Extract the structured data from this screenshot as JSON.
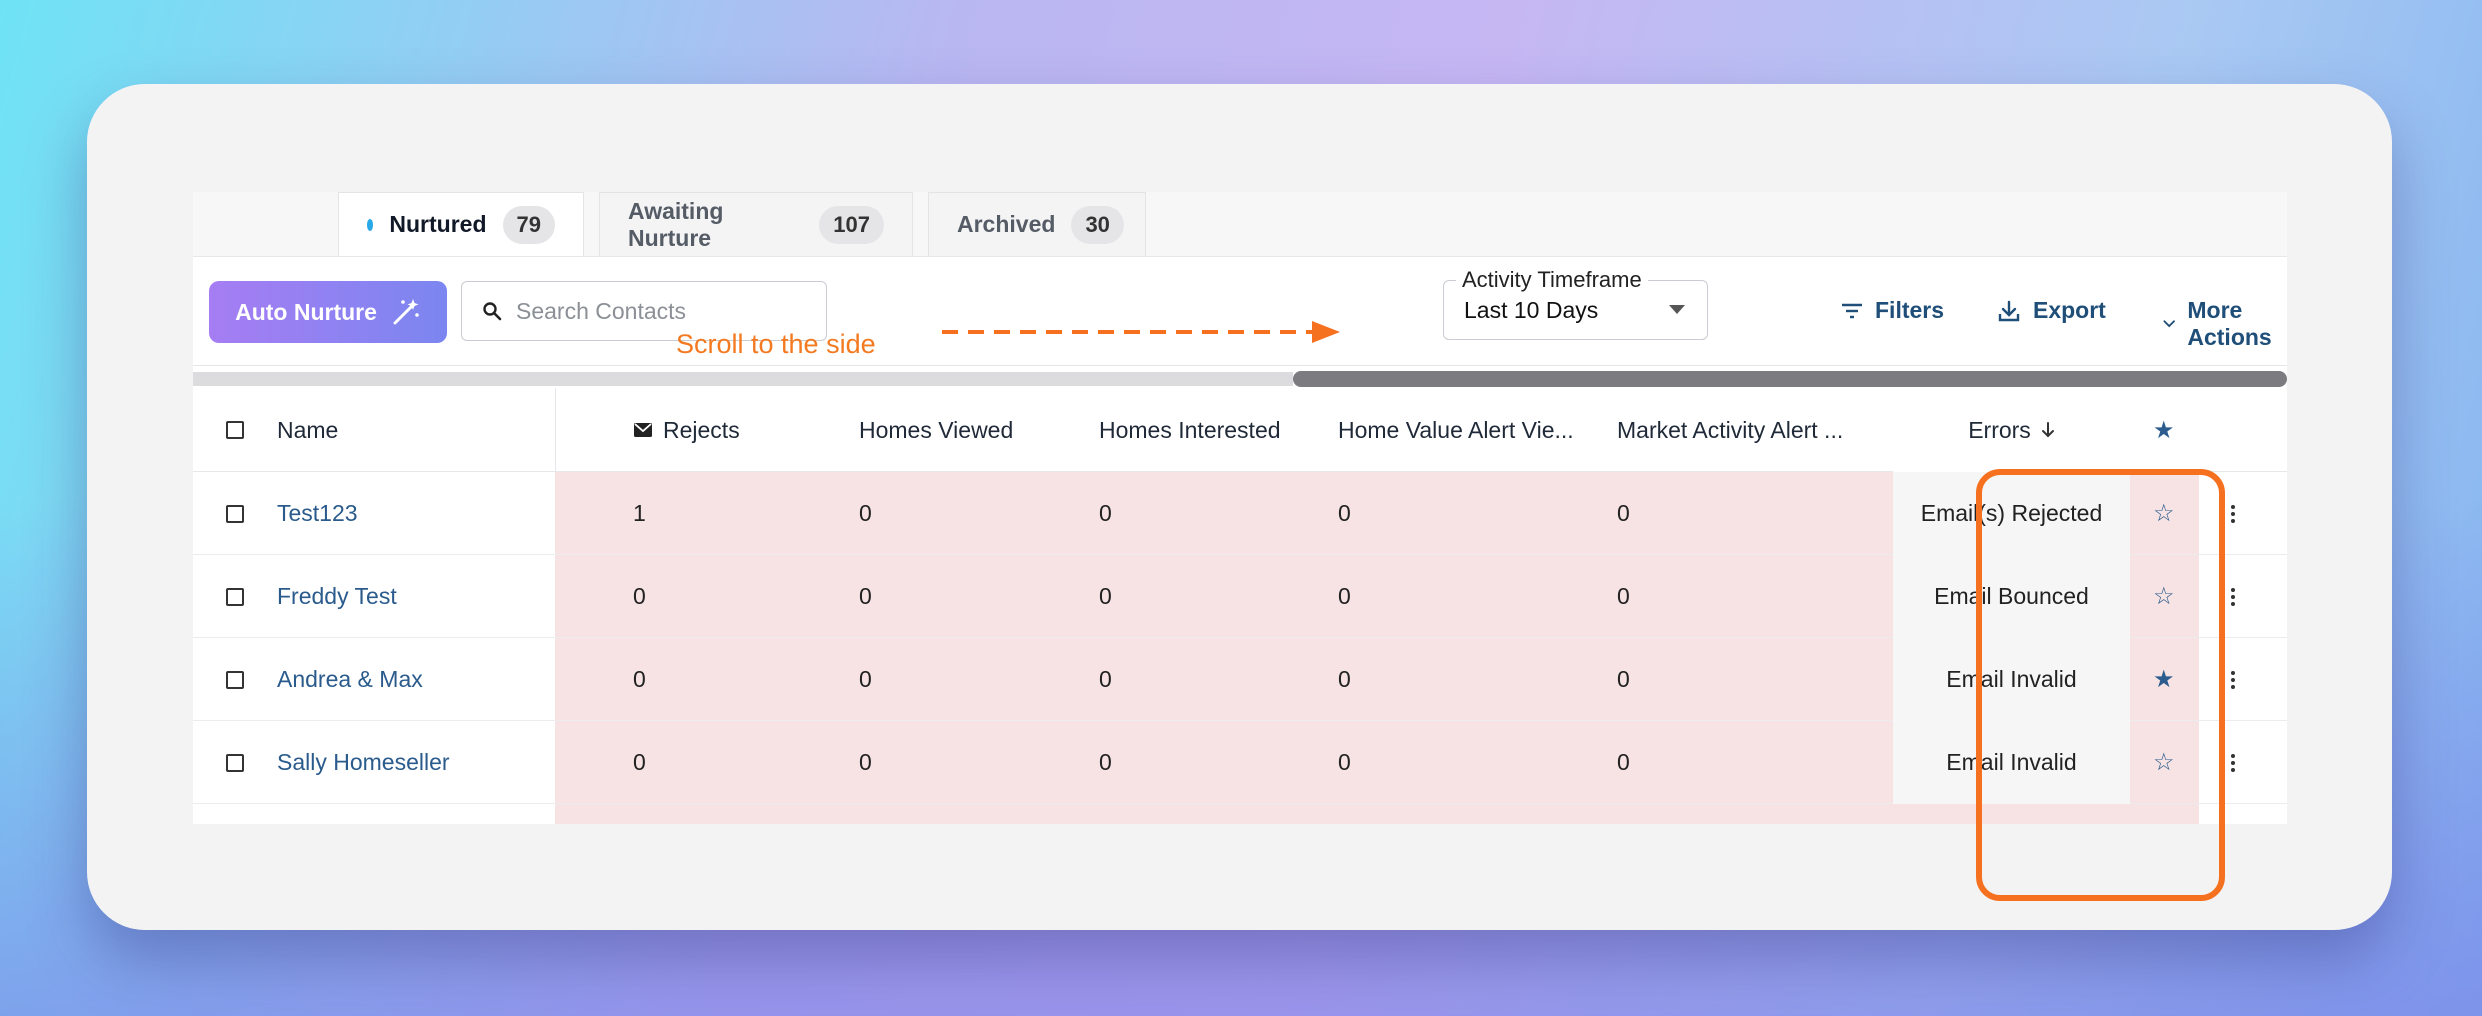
{
  "tabs": [
    {
      "label": "Nurtured",
      "count": "79"
    },
    {
      "label": "Awaiting Nurture",
      "count": "107"
    },
    {
      "label": "Archived",
      "count": "30"
    }
  ],
  "toolbar": {
    "auto_nurture": "Auto Nurture",
    "search_placeholder": "Search Contacts",
    "timeframe_label": "Activity Timeframe",
    "timeframe_value": "Last 10 Days",
    "filters": "Filters",
    "export": "Export",
    "more_actions": "More Actions"
  },
  "annotation": {
    "scroll_note": "Scroll to the side",
    "color": "#f57120"
  },
  "columns": {
    "name": "Name",
    "rejects": "Rejects",
    "homes_viewed": "Homes Viewed",
    "homes_interested": "Homes Interested",
    "home_value": "Home Value Alert Vie...",
    "market_activity": "Market Activity Alert ...",
    "errors": "Errors"
  },
  "rows": [
    {
      "name": "Test123",
      "rejects": "1",
      "homes_viewed": "0",
      "homes_interested": "0",
      "home_value": "0",
      "market": "0",
      "error": "Email(s) Rejected",
      "starred": false
    },
    {
      "name": "Freddy Test",
      "rejects": "0",
      "homes_viewed": "0",
      "homes_interested": "0",
      "home_value": "0",
      "market": "0",
      "error": "Email Bounced",
      "starred": false
    },
    {
      "name": "Andrea & Max",
      "rejects": "0",
      "homes_viewed": "0",
      "homes_interested": "0",
      "home_value": "0",
      "market": "0",
      "error": "Email Invalid",
      "starred": true
    },
    {
      "name": "Sally Homeseller",
      "rejects": "0",
      "homes_viewed": "0",
      "homes_interested": "0",
      "home_value": "0",
      "market": "0",
      "error": "Email Invalid",
      "starred": false
    }
  ],
  "colors": {
    "accent": "#1f4e79",
    "error_bg": "#f7e3e3",
    "gradient_start": "#a67df3",
    "gradient_end": "#7b86f0"
  }
}
